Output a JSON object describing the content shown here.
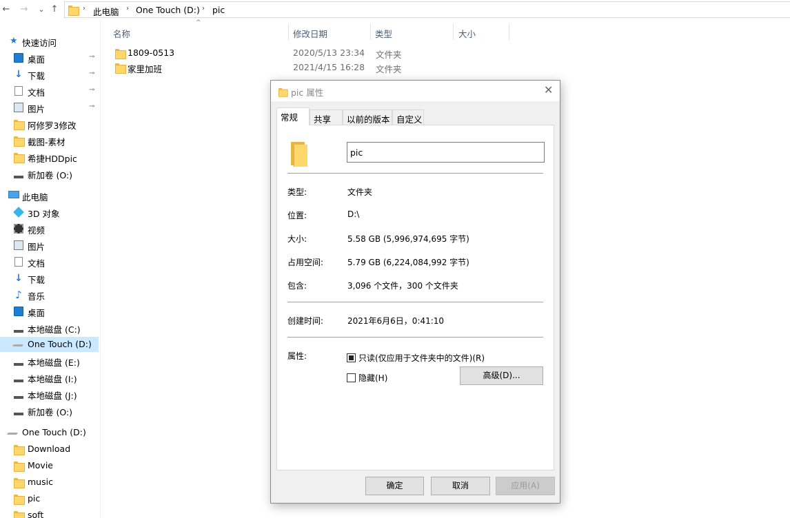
{
  "address_bar": {
    "back": "←",
    "forward": "→",
    "recent": "⌄",
    "up": "↑",
    "separator": "›",
    "crumbs": [
      "此电脑",
      "One Touch (D:)",
      "pic"
    ]
  },
  "nav": {
    "quick_access": "快速访问",
    "pin_glyph": "📌",
    "quick_items": [
      "桌面",
      "下载",
      "文档",
      "图片",
      "阿修罗3修改",
      "截图-素材",
      "希捷HDDpic",
      "新加卷 (O:)"
    ],
    "this_pc": "此电脑",
    "pc_items": [
      "3D 对象",
      "视频",
      "图片",
      "文档",
      "下载",
      "音乐",
      "桌面",
      "本地磁盘 (C:)",
      "One Touch (D:)",
      "本地磁盘 (E:)",
      "本地磁盘 (I:)",
      "本地磁盘 (J:)",
      "新加卷 (O:)"
    ],
    "drive_root": "One Touch (D:)",
    "drive_items": [
      "Download",
      "Movie",
      "music",
      "pic",
      "soft"
    ]
  },
  "columns": {
    "name": "名称",
    "modified": "修改日期",
    "type": "类型",
    "size": "大小",
    "sort_glyph": "^"
  },
  "files": [
    {
      "name": "1809-0513",
      "date": "2020/5/13 23:34",
      "type": "文件夹"
    },
    {
      "name": "家里加班",
      "date": "2021/4/15 16:28",
      "type": "文件夹"
    }
  ],
  "dialog": {
    "title": "pic 属性",
    "close": "✕",
    "tabs": [
      "常规",
      "共享",
      "以前的版本",
      "自定义"
    ],
    "folder_name": "pic",
    "props": {
      "type_label": "类型:",
      "type_value": "文件夹",
      "location_label": "位置:",
      "location_value": "D:\\",
      "size_label": "大小:",
      "size_value": "5.58 GB (5,996,974,695 字节)",
      "disk_size_label": "占用空间:",
      "disk_size_value": "5.79 GB (6,224,084,992 字节)",
      "contains_label": "包含:",
      "contains_value": "3,096 个文件，300 个文件夹",
      "created_label": "创建时间:",
      "created_value": "2021年6月6日，0:41:10",
      "attributes_label": "属性:"
    },
    "readonly_label": "只读(仅应用于文件夹中的文件)(R)",
    "readonly_state": "indeterminate",
    "hidden_label": "隐藏(H)",
    "hidden_state": "unchecked",
    "advanced_button": "高级(D)...",
    "ok_button": "确定",
    "cancel_button": "取消",
    "apply_button": "应用(A)"
  }
}
